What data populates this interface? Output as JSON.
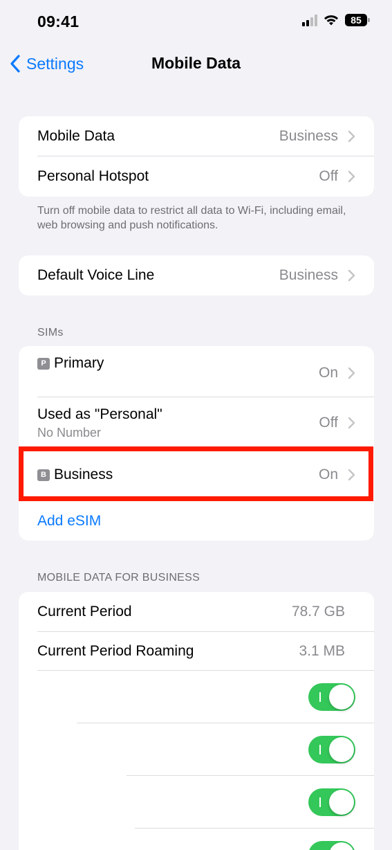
{
  "status_bar": {
    "time": "09:41",
    "battery": "85"
  },
  "nav": {
    "back_label": "Settings",
    "title": "Mobile Data"
  },
  "group1": {
    "mobile_data": {
      "label": "Mobile Data",
      "value": "Business"
    },
    "hotspot": {
      "label": "Personal Hotspot",
      "value": "Off"
    },
    "footnote": "Turn off mobile data to restrict all data to Wi-Fi, including email, web browsing and push notifications."
  },
  "voice": {
    "label": "Default Voice Line",
    "value": "Business"
  },
  "sims": {
    "header": "SIMs",
    "primary": {
      "badge": "P",
      "label": "Primary",
      "value": "On"
    },
    "personal": {
      "label": "Used as \"Personal\"",
      "sub": "No Number",
      "value": "Off"
    },
    "business": {
      "badge": "B",
      "label": "Business",
      "value": "On"
    },
    "add_esim": "Add eSIM"
  },
  "usage": {
    "header": "MOBILE DATA FOR BUSINESS",
    "current_period": {
      "label": "Current Period",
      "value": "78.7 GB"
    },
    "roaming": {
      "label": "Current Period Roaming",
      "value": "3.1 MB"
    },
    "toggles": [
      true,
      true,
      true,
      true
    ]
  },
  "colors": {
    "accent": "#0a7aff",
    "toggle_on": "#34c759",
    "highlight": "#ff1a00"
  }
}
